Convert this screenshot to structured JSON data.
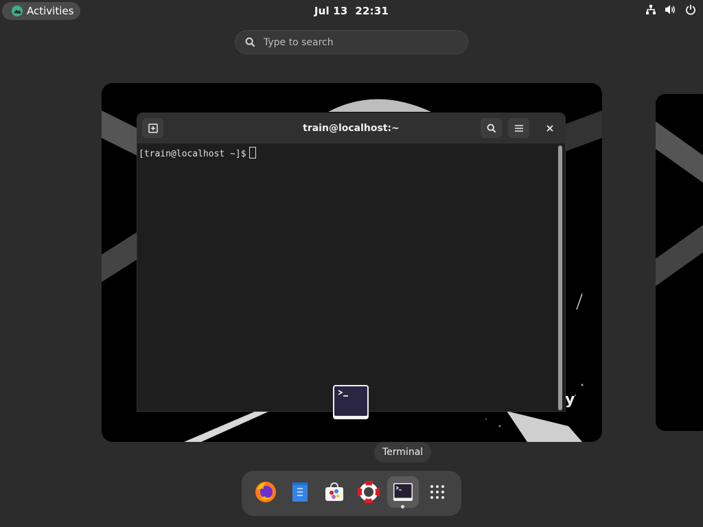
{
  "topbar": {
    "activities_label": "Activities",
    "date": "Jul 13",
    "time": "22:31",
    "tray_icons": [
      "network-icon",
      "volume-icon",
      "power-icon"
    ]
  },
  "search": {
    "placeholder": "Type to search"
  },
  "terminal": {
    "title": "train@localhost:~",
    "prompt": "[train@localhost ~]$"
  },
  "tooltip": {
    "label": "Terminal"
  },
  "dock": {
    "items": [
      "firefox-icon",
      "text-editor-icon",
      "software-icon",
      "help-icon",
      "terminal-icon",
      "app-grid-icon"
    ]
  },
  "colors": {
    "accent": "#3daf83",
    "panel": "#2c2c2c",
    "dock": "#424242"
  }
}
